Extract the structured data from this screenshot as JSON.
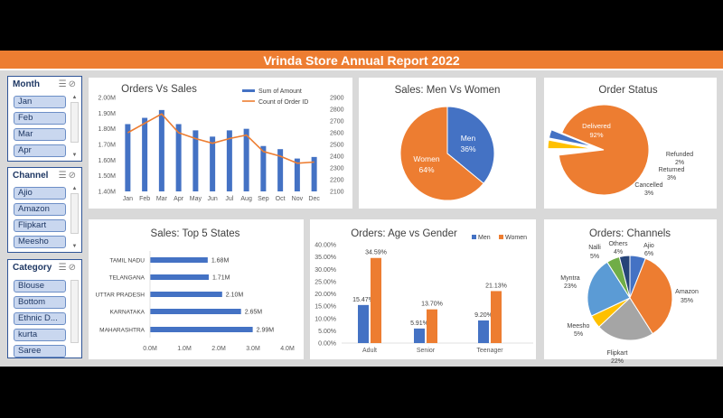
{
  "title": "Vrinda Store Annual Report 2022",
  "colors": {
    "accent": "#ed7d31",
    "blue": "#4472c4",
    "grey": "#a5a5a5",
    "yellow": "#ffc000",
    "lightblue": "#5b9bd5",
    "green": "#70ad47"
  },
  "slicers": {
    "month": {
      "header": "Month",
      "items": [
        "Jan",
        "Feb",
        "Mar",
        "Apr"
      ]
    },
    "channel": {
      "header": "Channel",
      "items": [
        "Ajio",
        "Amazon",
        "Flipkart",
        "Meesho"
      ]
    },
    "category": {
      "header": "Category",
      "items": [
        "Blouse",
        "Bottom",
        "Ethnic D...",
        "kurta",
        "Saree"
      ]
    }
  },
  "icons": {
    "multiselect": "multiselect-icon",
    "clearfilter": "clear-filter-icon"
  },
  "chart_data": [
    {
      "type": "bar",
      "title": "Orders Vs Sales",
      "categories": [
        "Jan",
        "Feb",
        "Mar",
        "Apr",
        "May",
        "Jun",
        "Jul",
        "Aug",
        "Sep",
        "Oct",
        "Nov",
        "Dec"
      ],
      "series": [
        {
          "name": "Sum of Amount",
          "chart": "bar",
          "axis": "left",
          "values": [
            1.83,
            1.87,
            1.92,
            1.83,
            1.79,
            1.75,
            1.79,
            1.8,
            1.69,
            1.67,
            1.61,
            1.62
          ]
        },
        {
          "name": "Count of Order ID",
          "chart": "line",
          "axis": "right",
          "values": [
            2600,
            2680,
            2760,
            2600,
            2550,
            2510,
            2550,
            2580,
            2440,
            2400,
            2340,
            2350
          ]
        }
      ],
      "yticks_left": [
        "2.00M",
        "1.90M",
        "1.80M",
        "1.70M",
        "1.60M",
        "1.50M",
        "1.40M"
      ],
      "yticks_right": [
        "2900",
        "2800",
        "2700",
        "2600",
        "2500",
        "2400",
        "2300",
        "2200",
        "2100"
      ],
      "ylim_left": [
        1.4,
        2.0
      ],
      "ylim_right": [
        2100,
        2900
      ],
      "legend": "top-right"
    },
    {
      "type": "pie",
      "title": "Sales: Men Vs Women",
      "slices": [
        {
          "label": "Men",
          "value": 36,
          "text": "36%",
          "color": "#4472c4"
        },
        {
          "label": "Women",
          "value": 64,
          "text": "64%",
          "color": "#ed7d31"
        }
      ]
    },
    {
      "type": "pie",
      "title": "Order Status",
      "slices": [
        {
          "label": "Delivered",
          "value": 92,
          "text": "92%",
          "color": "#ed7d31"
        },
        {
          "label": "Refunded",
          "value": 2,
          "text": "2%",
          "color": "#ffffff"
        },
        {
          "label": "Returned",
          "value": 3,
          "text": "3%",
          "color": "#ffc000"
        },
        {
          "label": "Cancelled",
          "value": 3,
          "text": "3%",
          "color": "#4472c4"
        }
      ]
    },
    {
      "type": "bar",
      "orientation": "horizontal",
      "title": "Sales: Top 5 States",
      "categories": [
        "TAMIL NADU",
        "TELANGANA",
        "UTTAR PRADESH",
        "KARNATAKA",
        "MAHARASHTRA"
      ],
      "values": [
        1.68,
        1.71,
        2.1,
        2.65,
        2.99
      ],
      "labels": [
        "1.68M",
        "1.71M",
        "2.10M",
        "2.65M",
        "2.99M"
      ],
      "xticks": [
        "0.0M",
        "1.0M",
        "2.0M",
        "3.0M",
        "4.0M"
      ],
      "xlim": [
        0,
        4
      ]
    },
    {
      "type": "bar",
      "title": "Orders: Age vs Gender",
      "categories": [
        "Adult",
        "Senior",
        "Teenager"
      ],
      "series": [
        {
          "name": "Men",
          "values": [
            15.47,
            5.91,
            9.2
          ],
          "labels": [
            "15.47%",
            "5.91%",
            "9.20%"
          ]
        },
        {
          "name": "Women",
          "values": [
            34.59,
            13.7,
            21.13
          ],
          "labels": [
            "34.59%",
            "13.70%",
            "21.13%"
          ]
        }
      ],
      "yticks": [
        "40.00%",
        "35.00%",
        "30.00%",
        "25.00%",
        "20.00%",
        "15.00%",
        "10.00%",
        "5.00%",
        "0.00%"
      ],
      "ylim": [
        0,
        40
      ],
      "legend": "top-right"
    },
    {
      "type": "pie",
      "title": "Orders: Channels",
      "slices": [
        {
          "label": "Ajio",
          "value": 6,
          "text": "6%",
          "color": "#4472c4"
        },
        {
          "label": "Amazon",
          "value": 35,
          "text": "35%",
          "color": "#ed7d31"
        },
        {
          "label": "Flipkart",
          "value": 22,
          "text": "22%",
          "color": "#a5a5a5"
        },
        {
          "label": "Meesho",
          "value": 5,
          "text": "5%",
          "color": "#ffc000"
        },
        {
          "label": "Myntra",
          "value": 23,
          "text": "23%",
          "color": "#5b9bd5"
        },
        {
          "label": "Nalli",
          "value": 5,
          "text": "5%",
          "color": "#70ad47"
        },
        {
          "label": "Others",
          "value": 4,
          "text": "4%",
          "color": "#264478"
        }
      ]
    }
  ]
}
